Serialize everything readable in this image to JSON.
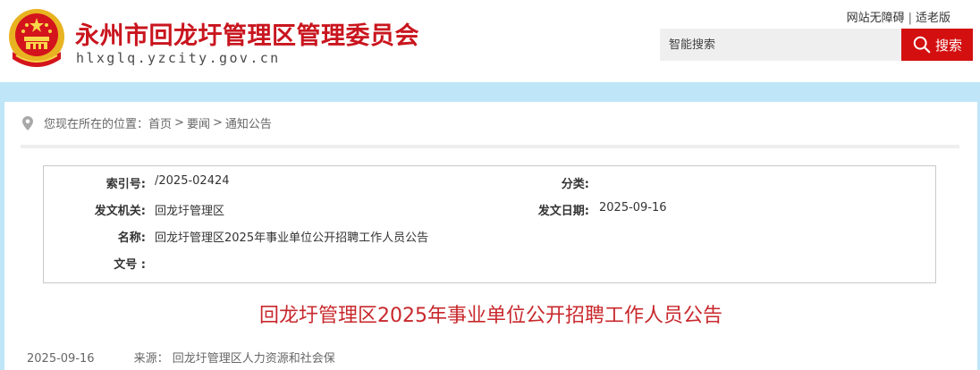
{
  "header": {
    "site_title": "永州市回龙圩管理区管理委员会",
    "site_domain": "hlxglq.yzcity.gov.cn",
    "links": [
      "网站无障碍",
      "适老版"
    ],
    "link_separator": "|",
    "search_placeholder": "智能搜索",
    "search_button": "搜索"
  },
  "breadcrumb": {
    "prefix": "您现在所在的位置：",
    "items": [
      "首页",
      "要闻",
      "通知公告"
    ],
    "separator": ">"
  },
  "meta": {
    "index_label": "索引号:",
    "index_value": "/2025-02424",
    "category_label": "分类:",
    "category_value": "",
    "issuer_label": "发文机关:",
    "issuer_value": "回龙圩管理区",
    "date_label": "发文日期:",
    "date_value": "2025-09-16",
    "name_label": "名称:",
    "name_value": "回龙圩管理区2025年事业单位公开招聘工作人员公告",
    "docno_label": "文号 :",
    "docno_value": ""
  },
  "article": {
    "title": "回龙圩管理区2025年事业单位公开招聘工作人员公告",
    "date": "2025-09-16",
    "source": "来源：  回龙圩管理区人力资源和社会保"
  },
  "colors": {
    "brand_red": "#c9151e",
    "search_red": "#d40f0f",
    "title_red": "#c8282c",
    "band_blue": "#bfe6f8"
  }
}
